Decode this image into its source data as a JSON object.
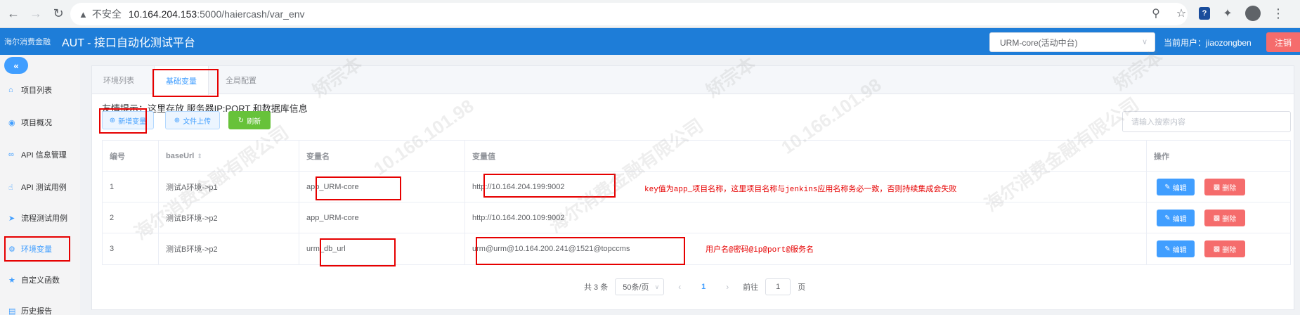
{
  "browser": {
    "insecure_label": "不安全",
    "url_host": "10.164.204.153",
    "url_path": ":5000/haiercash/var_env"
  },
  "header": {
    "logo_text": "海尔消费金融",
    "title": "AUT -  接口自动化测试平台",
    "project_select": "URM-core(活动中台)",
    "current_user": "当前用户：jiaozongben",
    "logout": "注销"
  },
  "sidebar": {
    "collapse": "«",
    "items": [
      {
        "label": "项目列表",
        "icon": "home-icon"
      },
      {
        "label": "项目概况",
        "icon": "eye-icon"
      },
      {
        "label": "API 信息管理",
        "icon": "link-icon"
      },
      {
        "label": "API 测试用例",
        "icon": "thumb-icon"
      },
      {
        "label": "流程测试用例",
        "icon": "send-icon"
      },
      {
        "label": "环境变量",
        "icon": "gear-icon"
      },
      {
        "label": "自定义函数",
        "icon": "star-icon"
      },
      {
        "label": "历史报告",
        "icon": "doc-icon"
      }
    ]
  },
  "tabs": [
    "环境列表",
    "基础变量",
    "全局配置"
  ],
  "tip": "友情提示：这里存放 服务器IP:PORT 和数据库信息",
  "toolbar": {
    "add": "新增变量",
    "upload": "文件上传",
    "refresh": "刷新",
    "search_placeholder": "请输入搜索内容"
  },
  "table": {
    "headers": [
      "编号",
      "baseUrl",
      "变量名",
      "变量值",
      "操作"
    ],
    "rows": [
      [
        "1",
        "测试A环境->p1",
        "app_URM-core",
        "http://10.164.204.199:9002"
      ],
      [
        "2",
        "测试B环境->p2",
        "app_URM-core",
        "http://10.164.200.109:9002"
      ],
      [
        "3",
        "测试B环境->p2",
        "urm_db_url",
        "urm@urm@10.164.200.241@1521@topccms"
      ]
    ],
    "edit": "编辑",
    "delete": "删除"
  },
  "notes": {
    "row1": "key值为app_项目名称，这里项目名称与jenkins应用名称务必一致，否则持续集成会失败",
    "row3": "用户名@密码@ip@port@服务名"
  },
  "pager": {
    "total": "共 3 条",
    "size": "50条/页",
    "current": "1",
    "goto_label": "前往",
    "goto_value": "1",
    "page_unit": "页"
  },
  "watermark": {
    "lines": [
      "海尔消费金融有限公司",
      "10.166.101.98",
      "矫宗本"
    ]
  }
}
